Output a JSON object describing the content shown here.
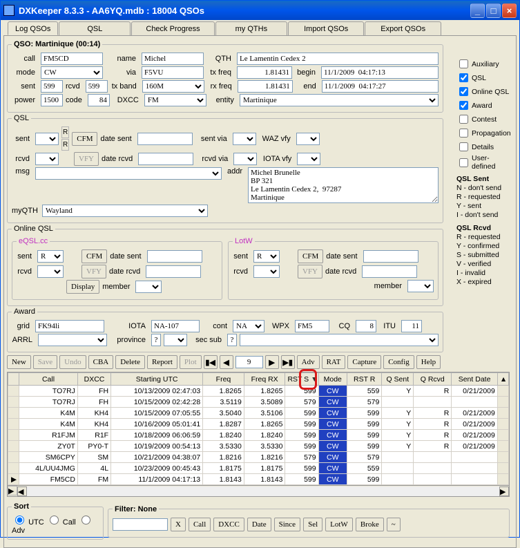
{
  "title": "DXKeeper 8.3.3 - AA6YQ.mdb : 18004 QSOs",
  "tabs": [
    "Log QSOs",
    "QSL",
    "Check Progress",
    "my QTHs",
    "Import QSOs",
    "Export QSOs"
  ],
  "activeTab": 0,
  "qso": {
    "legend": "QSO: Martinique (00:14)",
    "call": "FM5CD",
    "name": "Michel",
    "qth": "Le Lamentin Cedex 2",
    "mode": "CW",
    "via": "F5VU",
    "txfreq": "1.81431",
    "begin": "11/1/2009  04:17:13",
    "sent": "599",
    "rcvd": "599",
    "txband": "160M",
    "rxfreq": "1.81431",
    "end": "11/1/2009  04:17:27",
    "power": "1500",
    "code": "84",
    "dxcc": "FM",
    "entity": "Martinique",
    "labels": {
      "call": "call",
      "name": "name",
      "qth": "QTH",
      "mode": "mode",
      "via": "via",
      "txfreq": "tx freq",
      "begin": "begin",
      "sent": "sent",
      "rcvd": "rcvd",
      "txband": "tx band",
      "rxfreq": "rx freq",
      "end": "end",
      "power": "power",
      "code": "code",
      "dxcc": "DXCC",
      "entity": "entity"
    }
  },
  "sidechk": {
    "aux": "Auxiliary",
    "qsl": "QSL",
    "online": "Online QSL",
    "award": "Award",
    "contest": "Contest",
    "prop": "Propagation",
    "details": "Details",
    "user": "User-defined"
  },
  "legendSent": {
    "title": "QSL Sent",
    "n": "N - don't send",
    "r": "R - requested",
    "y": "Y - sent",
    "i": "I - don't send"
  },
  "legendRcvd": {
    "title": "QSL Rcvd",
    "r": "R - requested",
    "y": "Y - confirmed",
    "s": "S - submitted",
    "v": "V - verified",
    "i": "I - invalid",
    "x": "X - expired"
  },
  "qsl": {
    "legend": "QSL",
    "labels": {
      "sent": "sent",
      "cfm": "CFM",
      "dateSent": "date sent",
      "sentVia": "sent via",
      "wazVfy": "WAZ vfy",
      "rcvd": "rcvd",
      "vfy": "VFY",
      "dateRcvd": "date rcvd",
      "rcvdVia": "rcvd via",
      "iotaVfy": "IOTA vfy",
      "msg": "msg",
      "addr": "addr",
      "myQTH": "myQTH",
      "r": "R"
    },
    "addr": "Michel Brunelle\nBP 321\nLe Lamentin Cedex 2,  97287\nMartinique",
    "myQTH": "Wayland"
  },
  "onlineQSL": {
    "legend": "Online QSL",
    "eqsl": {
      "legend": "eQSL.cc",
      "sent": "R",
      "display": "Display",
      "member": "member"
    },
    "lotw": {
      "legend": "LotW",
      "sent": "R",
      "member": "member"
    },
    "labels": {
      "sent": "sent",
      "cfm": "CFM",
      "dateSent": "date sent",
      "rcvd": "rcvd",
      "vfy": "VFY",
      "dateRcvd": "date rcvd"
    }
  },
  "award": {
    "legend": "Award",
    "grid": "FK94li",
    "iota": "NA-107",
    "cont": "NA",
    "wpx": "FM5",
    "cq": "8",
    "itu": "11",
    "arrl": "",
    "province": "?",
    "secsub": "?",
    "labels": {
      "grid": "grid",
      "iota": "IOTA",
      "cont": "cont",
      "wpx": "WPX",
      "cq": "CQ",
      "itu": "ITU",
      "arrl": "ARRL",
      "province": "province",
      "secsub": "sec sub"
    }
  },
  "toolbar": {
    "new": "New",
    "save": "Save",
    "undo": "Undo",
    "cba": "CBA",
    "delete": "Delete",
    "report": "Report",
    "plot": "Plot",
    "record": "9",
    "adv": "Adv",
    "rat": "RAT",
    "capture": "Capture",
    "config": "Config",
    "help": "Help"
  },
  "gridHead": [
    "Call",
    "DXCC",
    "Starting UTC",
    "Freq",
    "Freq RX",
    "RST S",
    "Mode",
    "RST R",
    "Q Sent",
    "Q Rcvd",
    "Sent Date"
  ],
  "rows": [
    {
      "call": "TO7RJ",
      "dxcc": "FH",
      "utc": "10/13/2009  02:47:03",
      "freq": "1.8265",
      "frx": "1.8265",
      "rsts": "599",
      "mode": "CW",
      "rstr": "559",
      "qs": "Y",
      "qr": "R",
      "sent": "0/21/2009"
    },
    {
      "call": "TO7RJ",
      "dxcc": "FH",
      "utc": "10/15/2009  02:42:28",
      "freq": "3.5119",
      "frx": "3.5089",
      "rsts": "579",
      "mode": "CW",
      "rstr": "579",
      "qs": "",
      "qr": "",
      "sent": ""
    },
    {
      "call": "K4M",
      "dxcc": "KH4",
      "utc": "10/15/2009  07:05:55",
      "freq": "3.5040",
      "frx": "3.5106",
      "rsts": "599",
      "mode": "CW",
      "rstr": "599",
      "qs": "Y",
      "qr": "R",
      "sent": "0/21/2009"
    },
    {
      "call": "K4M",
      "dxcc": "KH4",
      "utc": "10/16/2009  05:01:41",
      "freq": "1.8287",
      "frx": "1.8265",
      "rsts": "599",
      "mode": "CW",
      "rstr": "599",
      "qs": "Y",
      "qr": "R",
      "sent": "0/21/2009"
    },
    {
      "call": "R1FJM",
      "dxcc": "R1F",
      "utc": "10/18/2009  06:06:59",
      "freq": "1.8240",
      "frx": "1.8240",
      "rsts": "599",
      "mode": "CW",
      "rstr": "599",
      "qs": "Y",
      "qr": "R",
      "sent": "0/21/2009"
    },
    {
      "call": "ZY0T",
      "dxcc": "PY0-T",
      "utc": "10/19/2009  00:54:13",
      "freq": "3.5330",
      "frx": "3.5330",
      "rsts": "599",
      "mode": "CW",
      "rstr": "599",
      "qs": "Y",
      "qr": "R",
      "sent": "0/21/2009"
    },
    {
      "call": "SM6CPY",
      "dxcc": "SM",
      "utc": "10/21/2009  04:38:07",
      "freq": "1.8216",
      "frx": "1.8216",
      "rsts": "579",
      "mode": "CW",
      "rstr": "579",
      "qs": "",
      "qr": "",
      "sent": ""
    },
    {
      "call": "4L/UU4JMG",
      "dxcc": "4L",
      "utc": "10/23/2009  00:45:43",
      "freq": "1.8175",
      "frx": "1.8175",
      "rsts": "599",
      "mode": "CW",
      "rstr": "559",
      "qs": "",
      "qr": "",
      "sent": ""
    },
    {
      "call": "FM5CD",
      "dxcc": "FM",
      "utc": "11/1/2009  04:17:13",
      "freq": "1.8143",
      "frx": "1.8143",
      "rsts": "599",
      "mode": "CW",
      "rstr": "599",
      "qs": "",
      "qr": "",
      "sent": ""
    }
  ],
  "sort": {
    "legend": "Sort",
    "utc": "UTC",
    "call": "Call",
    "adv": "Adv"
  },
  "filter": {
    "legend": "Filter: None",
    "x": "X",
    "call": "Call",
    "dxcc": "DXCC",
    "date": "Date",
    "since": "Since",
    "sel": "Sel",
    "lotw": "LotW",
    "broke": "Broke",
    "tilde": "~"
  }
}
